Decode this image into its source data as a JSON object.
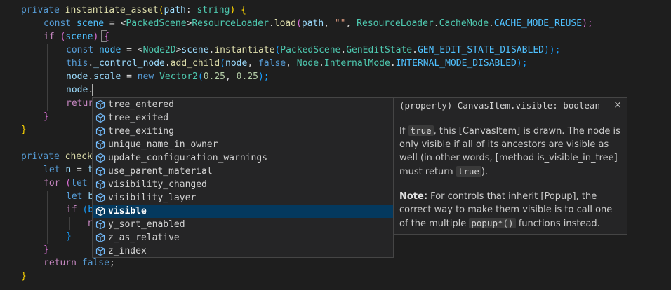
{
  "code": {
    "l1": {
      "kw": "private",
      "fn": "instantiate_asset",
      "p1": "(",
      "param": "path",
      "colon": ": ",
      "type": "string",
      "p2": ")",
      "sp": " ",
      "brace": "{"
    },
    "l2": {
      "kw": "const",
      "var": "scene",
      "eq": " = ",
      "lt": "<",
      "type": "PackedScene",
      "gt": ">",
      "obj": "ResourceLoader",
      "dot": ".",
      "fn": "load",
      "p1": "(",
      "arg": "path",
      "comma": ", ",
      "str": "\"\"",
      "comma2": ", ",
      "obj2": "ResourceLoader",
      "dot2": ".",
      "enum": "CacheMode",
      "dot3": ".",
      "const": "CACHE_MODE_REUSE",
      "p2": ");"
    },
    "l3": {
      "kw": "if",
      "p1": " (",
      "var": "scene",
      "p2": ")",
      "sp": " ",
      "brace": "{"
    },
    "l4": {
      "kw": "const",
      "var": "node",
      "eq": " = ",
      "lt": "<",
      "type": "Node2D",
      "gt": ">",
      "obj": "scene",
      "dot": ".",
      "fn": "instantiate",
      "p1": "(",
      "cls": "PackedScene",
      "dot2": ".",
      "enum": "GenEditState",
      "dot3": ".",
      "const": "GEN_EDIT_STATE_DISABLED",
      "p2": "));"
    },
    "l5": {
      "kw": "this",
      "dot": ".",
      "prop": "_control_node",
      "dot2": ".",
      "fn": "add_child",
      "p1": "(",
      "arg": "node",
      "comma": ", ",
      "bool": "false",
      "comma2": ", ",
      "cls": "Node",
      "dot3": ".",
      "enum": "InternalMode",
      "dot4": ".",
      "const": "INTERNAL_MODE_DISABLED",
      "p2": ");"
    },
    "l6": {
      "obj": "node",
      "dot": ".",
      "prop": "scale",
      "eq": " = ",
      "kw": "new",
      "sp": " ",
      "type": "Vector2",
      "p1": "(",
      "n1": "0.25",
      "comma": ", ",
      "n2": "0.25",
      "p2": ");"
    },
    "l7": {
      "obj": "node",
      "dot": "."
    },
    "l8": {
      "kw": "retur"
    },
    "l9": {
      "brace": "}"
    },
    "l10": {
      "brace": "}"
    },
    "l12": {
      "kw": "private",
      "fn": "check"
    },
    "l13": {
      "kw": "let",
      "var": "n",
      "eq": " = ",
      "rest": "t"
    },
    "l14": {
      "kw": "for",
      "p": " (",
      "kw2": "let"
    },
    "l15": {
      "kw": "let",
      "rest": "b"
    },
    "l16": {
      "kw": "if",
      "p": " (b"
    },
    "l17": {
      "rest": "r"
    },
    "l18": {
      "brace": "}"
    },
    "l19": {
      "brace": "}"
    },
    "l20": {
      "kw": "return",
      "sp": " ",
      "bool": "false",
      "semi": ";"
    },
    "l21": {
      "brace": "}"
    }
  },
  "suggestions": {
    "items": [
      "tree_entered",
      "tree_exited",
      "tree_exiting",
      "unique_name_in_owner",
      "update_configuration_warnings",
      "use_parent_material",
      "visibility_changed",
      "visibility_layer",
      "visible",
      "y_sort_enabled",
      "z_as_relative",
      "z_index"
    ],
    "selected_label": "visible",
    "icon": "cube-icon"
  },
  "hover": {
    "signature": "(property) CanvasItem.visible: boolean",
    "close": "×",
    "p1": {
      "a": "If ",
      "code1": "true",
      "b": ", this [CanvasItem] is drawn. The node is only visible if all of its ancestors are visible as well (in other words, [method is_visible_in_tree] must return ",
      "code2": "true",
      "c": ")."
    },
    "p2": {
      "label": "Note:",
      "a": " For controls that inherit [Popup], the correct way to make them visible is to call one of the multiple ",
      "code": "popup*()",
      "b": " functions instead."
    }
  },
  "colors": {
    "background": "#1e1e1e",
    "keyword": "#569cd6",
    "control_keyword": "#c586c0",
    "function": "#dcdcaa",
    "variable": "#9cdcfe",
    "type": "#4ec9b0",
    "string": "#ce9178",
    "number": "#b5cea8",
    "enum_member": "#4fc1ff",
    "selection": "#04395e",
    "widget_bg": "#252526"
  }
}
